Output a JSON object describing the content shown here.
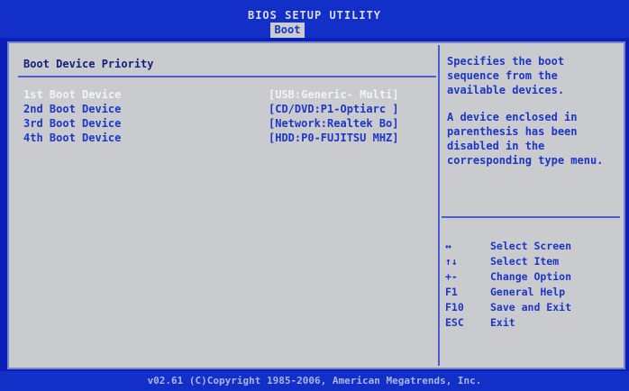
{
  "header": {
    "title": "BIOS SETUP UTILITY",
    "active_tab": "Boot"
  },
  "section": {
    "title": "Boot Device Priority"
  },
  "boot_devices": [
    {
      "label": "1st Boot Device",
      "value": "[USB:Generic- Multi]",
      "selected": true
    },
    {
      "label": "2nd Boot Device",
      "value": "[CD/DVD:P1-Optiarc ]",
      "selected": false
    },
    {
      "label": "3rd Boot Device",
      "value": "[Network:Realtek Bo]",
      "selected": false
    },
    {
      "label": "4th Boot Device",
      "value": "[HDD:P0-FUJITSU MHZ]",
      "selected": false
    }
  ],
  "help": {
    "line1": "Specifies the boot sequence from the available devices.",
    "line2": "A device enclosed in parenthesis has been disabled in the corresponding type menu."
  },
  "keys": [
    {
      "key": "↔",
      "desc": "Select Screen"
    },
    {
      "key": "↑↓",
      "desc": "Select Item"
    },
    {
      "key": "+-",
      "desc": "Change Option"
    },
    {
      "key": "F1",
      "desc": "General Help"
    },
    {
      "key": "F10",
      "desc": "Save and Exit"
    },
    {
      "key": "ESC",
      "desc": "Exit"
    }
  ],
  "footer": "v02.61 (C)Copyright 1985-2006, American Megatrends, Inc.",
  "colors": {
    "background": "#0a1fb8",
    "panel": "#c9cbce",
    "text_blue": "#1e36c6",
    "selected_text": "#f2f3f5"
  }
}
